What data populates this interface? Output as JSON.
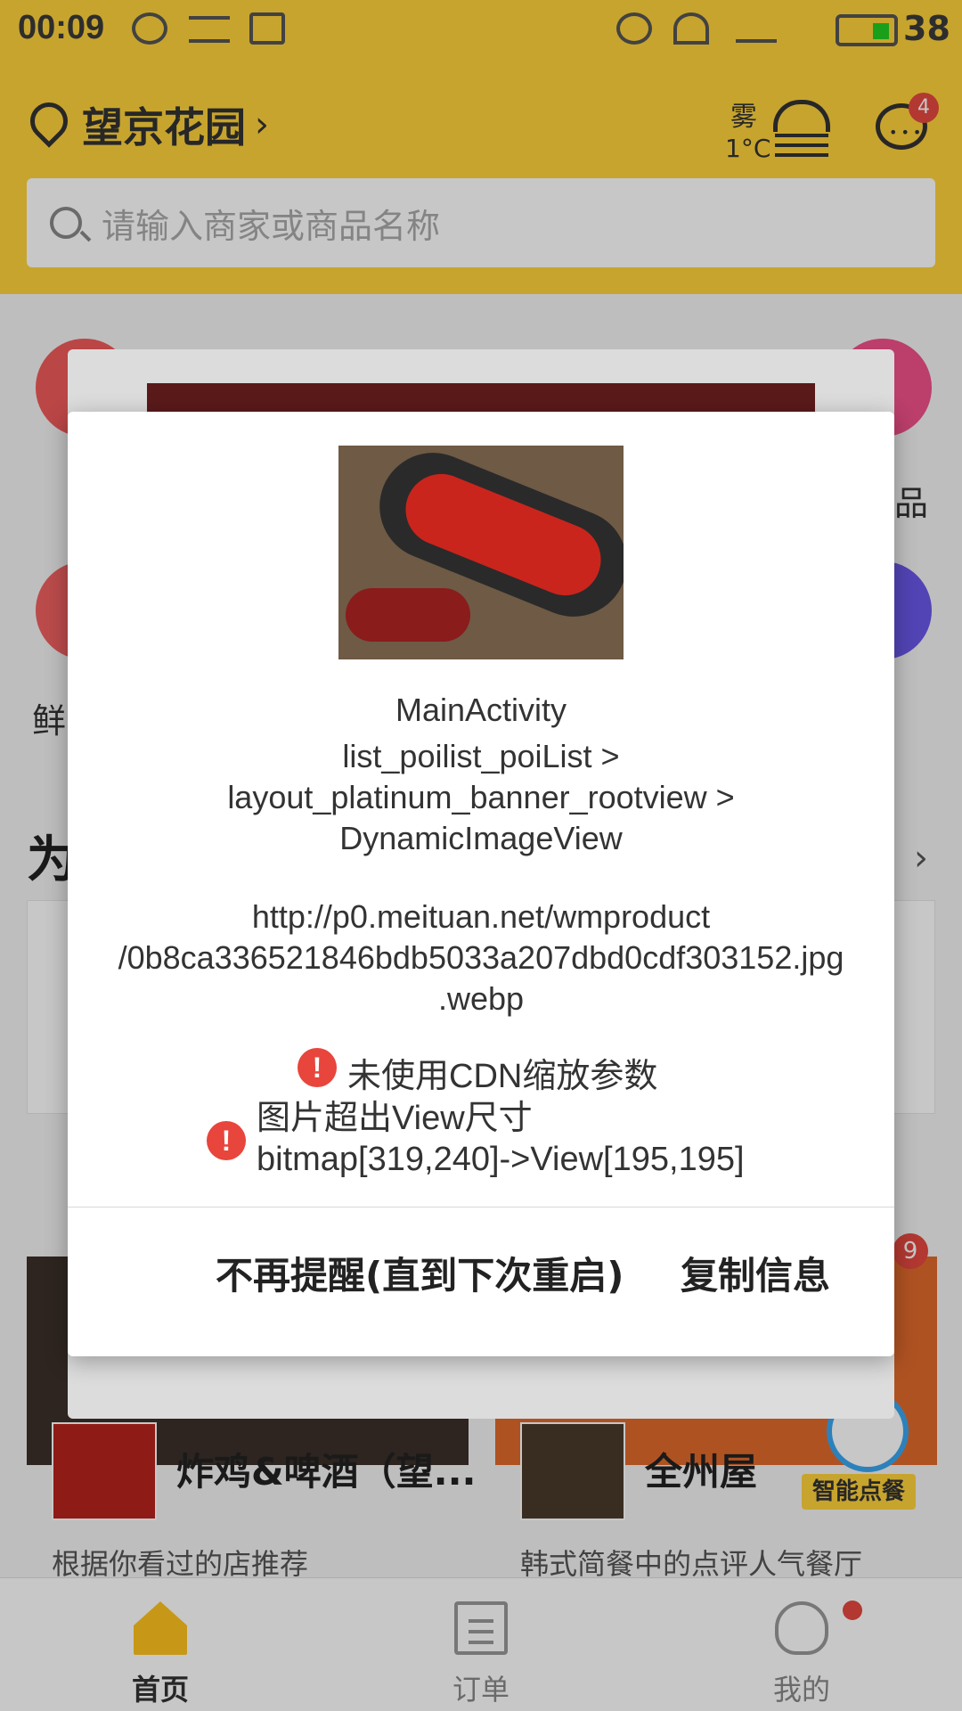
{
  "statusbar": {
    "time": "00:09",
    "battery": "38"
  },
  "header": {
    "location": "望京花园",
    "weather": {
      "condition": "雾",
      "temp": "1°C"
    },
    "message_badge": "4",
    "search_placeholder": "请输入商家或商品名称"
  },
  "content": {
    "left_char": "鲜",
    "right_char": "品",
    "section_title": "为",
    "cards": [
      {
        "name": "炸鸡&啤酒（望...",
        "subtitle": "根据你看过的店推荐"
      },
      {
        "name": "全州屋",
        "subtitle": "韩式简餐中的点评人气餐厅",
        "tag": "智能点餐",
        "badge": "9"
      }
    ]
  },
  "dialog": {
    "activity": "MainActivity",
    "view_path": [
      "list_poilist_poiList >",
      "layout_platinum_banner_rootview >",
      "DynamicImageView"
    ],
    "url": [
      "http://p0.meituan.net/wmproduct",
      "/0b8ca336521846bdb5033a207dbd0cdf303152.jpg",
      ".webp"
    ],
    "warnings": [
      {
        "icon": "!",
        "text": "未使用CDN缩放参数"
      },
      {
        "icon": "!",
        "lines": [
          "图片超出View尺寸",
          "bitmap[319,240]->View[195,195]"
        ]
      }
    ],
    "buttons": {
      "dismiss": "不再提醒(直到下次重启)",
      "copy": "复制信息"
    }
  },
  "bottomnav": {
    "tabs": [
      {
        "label": "首页"
      },
      {
        "label": "订单"
      },
      {
        "label": "我的"
      }
    ]
  },
  "colors": {
    "brand_yellow": "#ffd23b",
    "warning_red": "#e8453c",
    "badge_red": "#e5483f"
  }
}
